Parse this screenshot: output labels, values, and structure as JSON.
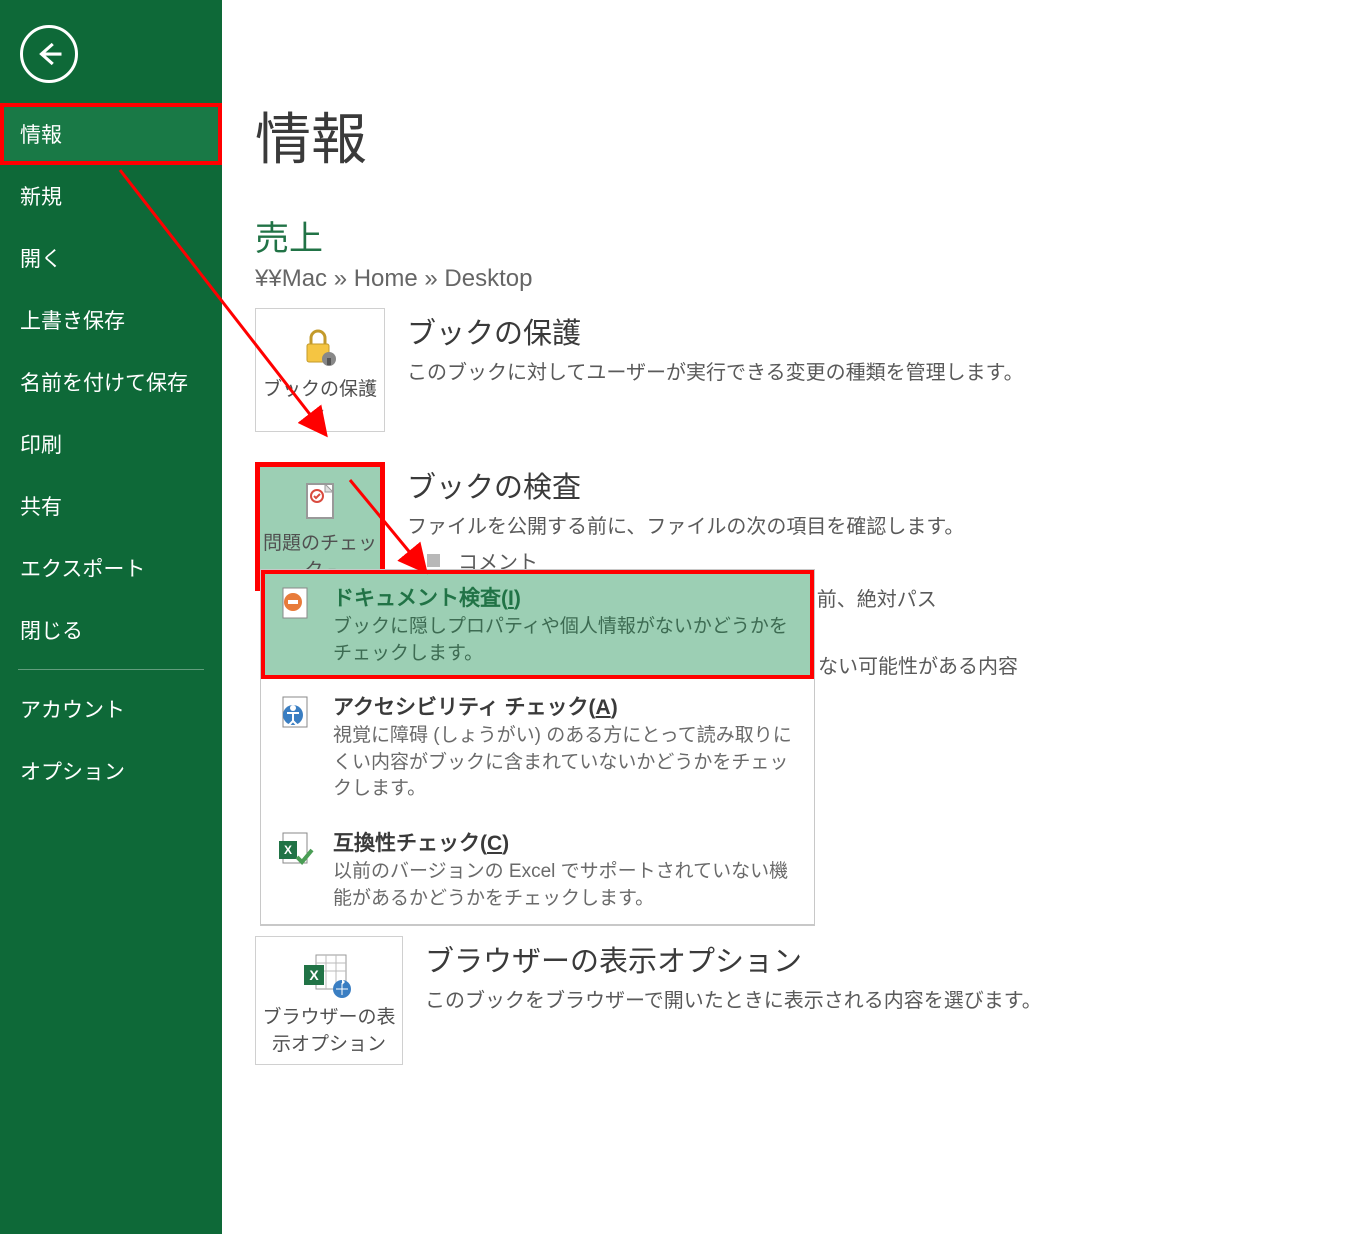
{
  "sidebar": {
    "items": [
      {
        "label": "情報",
        "selected": true
      },
      {
        "label": "新規"
      },
      {
        "label": "開く"
      },
      {
        "label": "上書き保存"
      },
      {
        "label": "名前を付けて保存"
      },
      {
        "label": "印刷"
      },
      {
        "label": "共有"
      },
      {
        "label": "エクスポート"
      },
      {
        "label": "閉じる"
      }
    ],
    "footer_items": [
      {
        "label": "アカウント"
      },
      {
        "label": "オプション"
      }
    ]
  },
  "page_title": "情報",
  "file_name": "売上",
  "breadcrumb": "¥¥Mac » Home » Desktop",
  "protect": {
    "tile_label": "ブックの保護",
    "title": "ブックの保護",
    "desc": "このブックに対してユーザーが実行できる変更の種類を管理します。"
  },
  "inspect": {
    "tile_label": "問題のチェック",
    "title": "ブックの検査",
    "desc": "ファイルを公開する前に、ファイルの次の項目を確認します。",
    "bullets": [
      "コメント",
      "ドキュメントのプロパティ、作成者の名前、絶対パス"
    ],
    "trailing_text": "ない可能性がある内容"
  },
  "dropdown": [
    {
      "title_pre": "ドキュメント検査(",
      "key": "I",
      "title_post": ")",
      "desc": "ブックに隠しプロパティや個人情報がないかどうかをチェックします。",
      "hl": true
    },
    {
      "title_pre": "アクセシビリティ チェック(",
      "key": "A",
      "title_post": ")",
      "desc": "視覚に障碍 (しょうがい) のある方にとって読み取りにくい内容がブックに含まれていないかどうかをチェックします。"
    },
    {
      "title_pre": "互換性チェック(",
      "key": "C",
      "title_post": ")",
      "desc": "以前のバージョンの Excel でサポートされていない機能があるかどうかをチェックします。"
    }
  ],
  "browser": {
    "tile_label": "ブラウザーの表示オプション",
    "title": "ブラウザーの表示オプション",
    "desc": "このブックをブラウザーで開いたときに表示される内容を選びます。"
  }
}
